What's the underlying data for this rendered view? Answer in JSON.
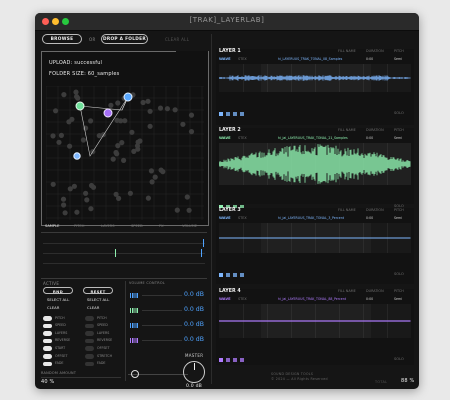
{
  "window": {
    "title": "[TRAK]_LAYERLAB]"
  },
  "toolbar": {
    "browse": "BROWSE",
    "or": "OR",
    "drop": "DROP A FOLDER",
    "clear": "CLEAR ALL"
  },
  "upload": {
    "status": "UPLOAD: successful",
    "folder": "FOLDER SIZE: 60_samples"
  },
  "sample_tabs": [
    "SAMPLE",
    "PITCH",
    "LAYERS",
    "SPEED",
    "FX",
    "VOLUME"
  ],
  "left_controls": {
    "header": "ACTIVE",
    "rnd": "RND",
    "reset": "RESET",
    "select_all": "SELECT ALL",
    "clear": "CLEAR",
    "col1": [
      "PITCH",
      "SPEED",
      "LAYERS",
      "REVERSE",
      "START",
      "OFFSET",
      "FADE"
    ],
    "col2": [
      "PITCH",
      "SPEED",
      "LAYERS",
      "REVERSE",
      "OFFSET",
      "STRETCH",
      "FADE"
    ],
    "random_header": "RANDOM AMOUNT",
    "random_value": "40 %"
  },
  "volume": {
    "header": "VOLUME CONTROL",
    "values": [
      "0.0 dB",
      "0.0 dB",
      "0.0 dB",
      "0.0 dB"
    ],
    "master_label": "MASTER",
    "master_value": "0.0 dB"
  },
  "layers": [
    {
      "name": "LAYER 1",
      "file": "hi_LAYERUUS_TRAK_TONAL_08_Samples",
      "color": "#7fb8ff",
      "meta": [
        "FILL NAME",
        "DURATION",
        "PITCH"
      ],
      "vals": [
        "",
        "0:00",
        "Semi"
      ],
      "mode": "WAVE",
      "stereo": "STEX",
      "solo": "SOLO"
    },
    {
      "name": "LAYER 2",
      "file": "hi_jai_LAYERUUS_TRAK_TONAL_21_Samples",
      "color": "#8ff0b0",
      "meta": [
        "FILL NAME",
        "DURATION",
        "PITCH"
      ],
      "vals": [
        "",
        "0:00",
        "Semi"
      ],
      "mode": "WAVE",
      "stereo": "STEX",
      "solo": "SOLO"
    },
    {
      "name": "LAYER 3",
      "file": "hi_jai_LAYERUUS_TRAK_TONAL_3_Percent",
      "color": "#7fb8ff",
      "meta": [
        "FILL NAME",
        "DURATION",
        "PITCH"
      ],
      "vals": [
        "",
        "0:00",
        "Semi"
      ],
      "mode": "WAVE",
      "stereo": "STEX",
      "solo": "SOLO"
    },
    {
      "name": "LAYER 4",
      "file": "hi_jai_LAYERUUS_TRAK_TONAL_88_Percent",
      "color": "#b07cff",
      "meta": [
        "FILL NAME",
        "DURATION",
        "PITCH"
      ],
      "vals": [
        "",
        "0:00",
        "Semi"
      ],
      "mode": "WAVE",
      "stereo": "STEX",
      "solo": "SOLO"
    }
  ],
  "footer": {
    "credits_1": "SOUND DESIGN TOOLS",
    "credits_2": "© 2024 — All Rights Reserved",
    "left": "TOTAL",
    "right": "88 %"
  },
  "colors": {
    "accent_blue": "#4fa3ff",
    "accent_green": "#8ff0b0",
    "accent_purple": "#b07cff"
  }
}
